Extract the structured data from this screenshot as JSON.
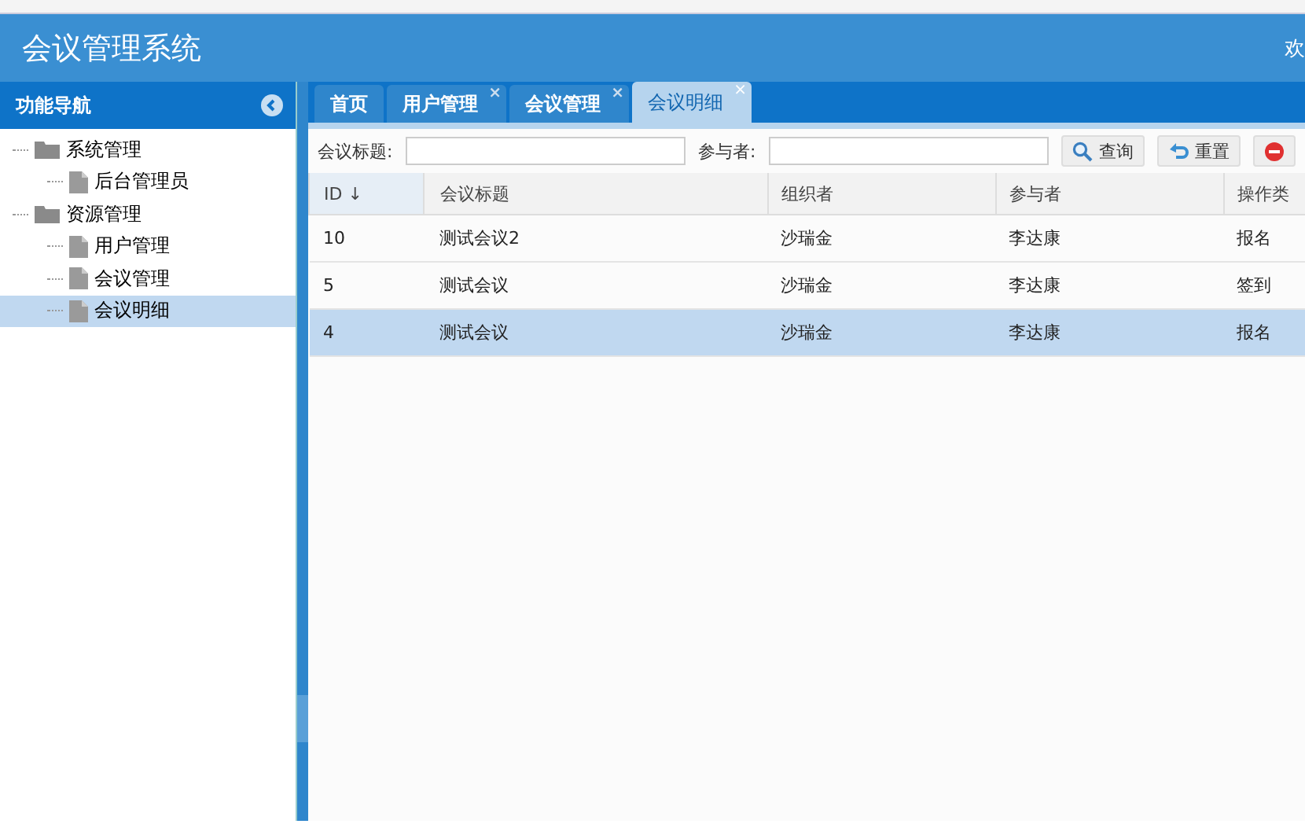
{
  "header": {
    "title": "会议管理系统",
    "welcome": "欢"
  },
  "sidebar": {
    "title": "功能导航",
    "tree": [
      {
        "label": "系统管理",
        "kind": "folder",
        "selected": false,
        "children": [
          {
            "label": "后台管理员",
            "kind": "file",
            "selected": false
          }
        ]
      },
      {
        "label": "资源管理",
        "kind": "folder",
        "selected": false,
        "children": [
          {
            "label": "用户管理",
            "kind": "file",
            "selected": false
          },
          {
            "label": "会议管理",
            "kind": "file",
            "selected": false
          },
          {
            "label": "会议明细",
            "kind": "file",
            "selected": true
          }
        ]
      }
    ]
  },
  "tabs": [
    {
      "label": "首页",
      "selected": false
    },
    {
      "label": "用户管理",
      "selected": false,
      "close": "×"
    },
    {
      "label": "会议管理",
      "selected": false,
      "close": "×"
    },
    {
      "label": "会议明细",
      "selected": true,
      "close": "×"
    }
  ],
  "filters": [
    {
      "label": "会议标题:"
    },
    {
      "label": "参与者:"
    }
  ],
  "buttons": [
    {
      "label": "查询",
      "kind": "search"
    },
    {
      "label": "重置",
      "kind": "reset"
    },
    {
      "kind": "delete"
    }
  ],
  "table": {
    "columns": [
      {
        "label": "ID",
        "sort": "↓"
      },
      {
        "label": "会议标题"
      },
      {
        "label": "组织者"
      },
      {
        "label": "参与者"
      },
      {
        "label": "操作类"
      }
    ],
    "rows": [
      {
        "cells": [
          "10",
          "测试会议2",
          "沙瑞金",
          "李达康",
          "报名"
        ],
        "selected": false
      },
      {
        "cells": [
          "5",
          "测试会议",
          "沙瑞金",
          "李达康",
          "签到"
        ],
        "selected": false
      },
      {
        "cells": [
          "4",
          "测试会议",
          "沙瑞金",
          "李达康",
          "报名"
        ],
        "selected": true
      }
    ]
  }
}
